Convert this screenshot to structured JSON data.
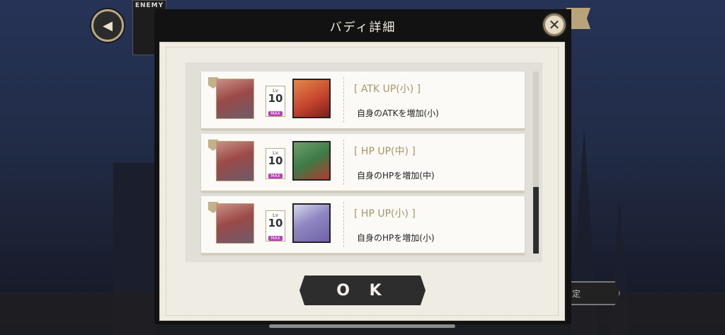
{
  "background": {
    "enemy_label": "ENEMY",
    "right_button_label": "定",
    "back_icon": "chevron-left-icon"
  },
  "modal": {
    "title": "バディ詳細",
    "close_icon": "close-icon",
    "ok_label": "O K",
    "buddies": [
      {
        "lv_label": "Lv",
        "level": "10",
        "max_label": "MAX",
        "skill_title": "[ ATK UP(小) ]",
        "skill_desc": "自身のATKを増加(小)",
        "portrait_color": "#c7452f"
      },
      {
        "lv_label": "Lv",
        "level": "10",
        "max_label": "MAX",
        "skill_title": "[ HP UP(中) ]",
        "skill_desc": "自身のHPを増加(中)",
        "portrait_color": "#3d7a47"
      },
      {
        "lv_label": "Lv",
        "level": "10",
        "max_label": "MAX",
        "skill_title": "[ HP UP(小) ]",
        "skill_desc": "自身のHPを増加(小)",
        "portrait_color": "#6f62a8"
      }
    ]
  }
}
